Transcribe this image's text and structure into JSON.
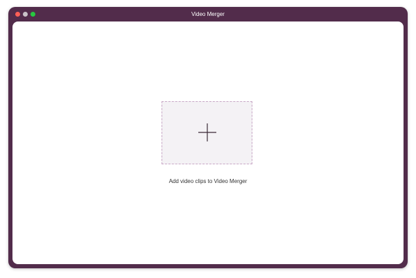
{
  "window": {
    "title": "Video Merger",
    "frame_color": "#522c4b",
    "traffic_lights": {
      "close_color": "#fe5f57",
      "minimize_color": "#c9c3c8",
      "zoom_color": "#27c840"
    }
  },
  "main": {
    "add_icon": "plus-icon",
    "hint": "Add video clips to Video Merger"
  }
}
